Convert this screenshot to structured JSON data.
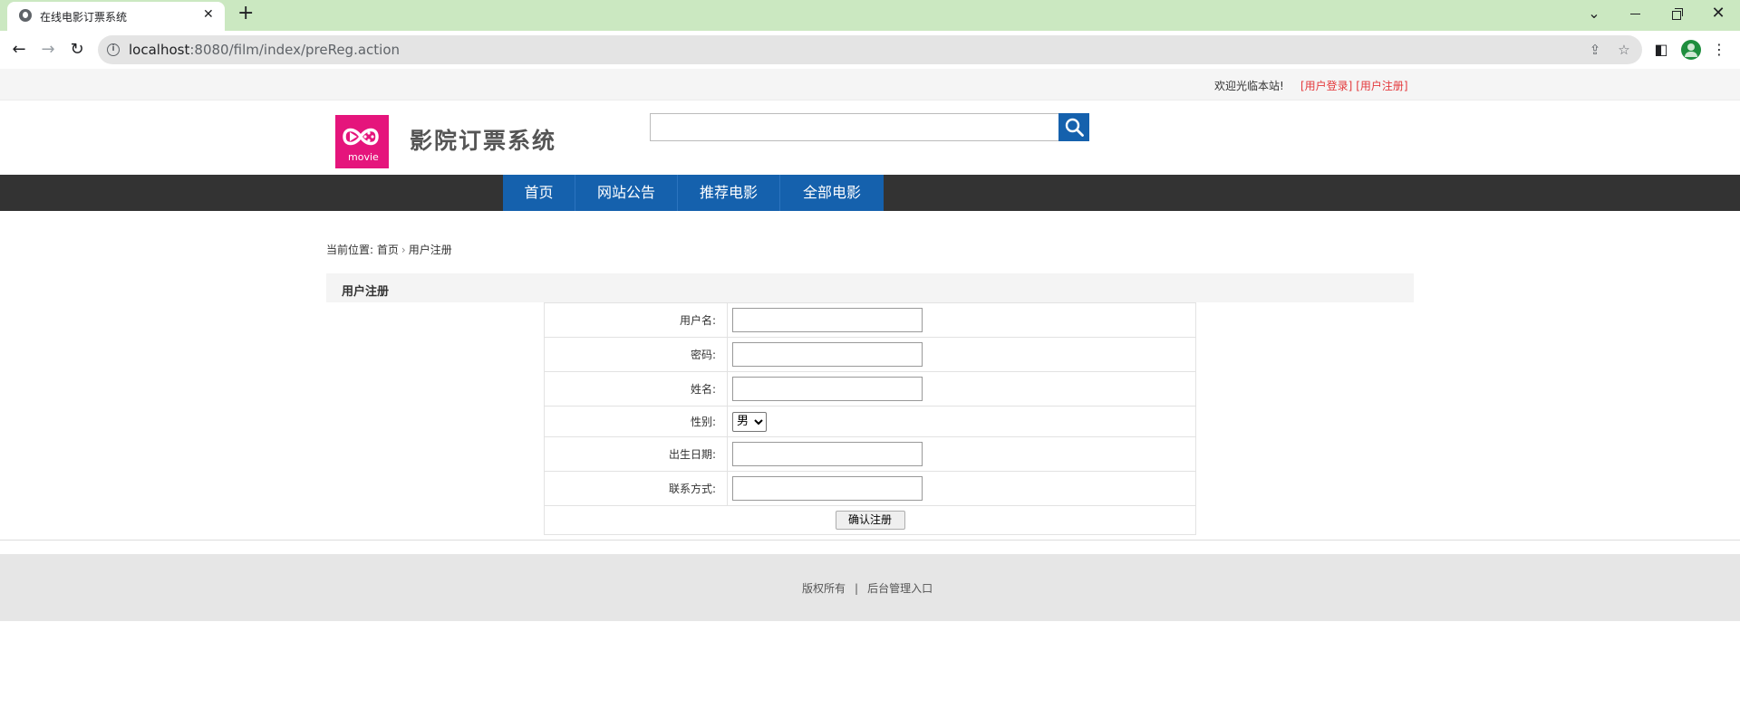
{
  "browser": {
    "tab_title": "在线电影订票系统",
    "tab_close": "✕",
    "new_tab": "+",
    "url_host": "localhost",
    "url_rest": ":8080/film/index/preReg.action"
  },
  "topbar": {
    "welcome": "欢迎光临本站!",
    "login": "[用户登录]",
    "register": "[用户注册]"
  },
  "header": {
    "logo_text": "movie",
    "site_title": "影院订票系统",
    "search_placeholder": ""
  },
  "nav": {
    "items": [
      "首页",
      "网站公告",
      "推荐电影",
      "全部电影"
    ]
  },
  "breadcrumb": {
    "prefix": "当前位置:",
    "home": "首页",
    "separator": "›",
    "current": "用户注册"
  },
  "panel": {
    "title": "用户注册"
  },
  "form": {
    "username_label": "用户名:",
    "password_label": "密码:",
    "name_label": "姓名:",
    "sex_label": "性别:",
    "sex_value": "男",
    "birthday_label": "出生日期:",
    "contact_label": "联系方式:",
    "submit_label": "确认注册"
  },
  "footer": {
    "copyright": "版权所有",
    "divider": "|",
    "admin_link": "后台管理入口"
  },
  "colors": {
    "brand_blue": "#1561ad",
    "logo_pink": "#e5157c",
    "link_red": "#e4393c",
    "tabbar_green": "#cbe8c1"
  }
}
